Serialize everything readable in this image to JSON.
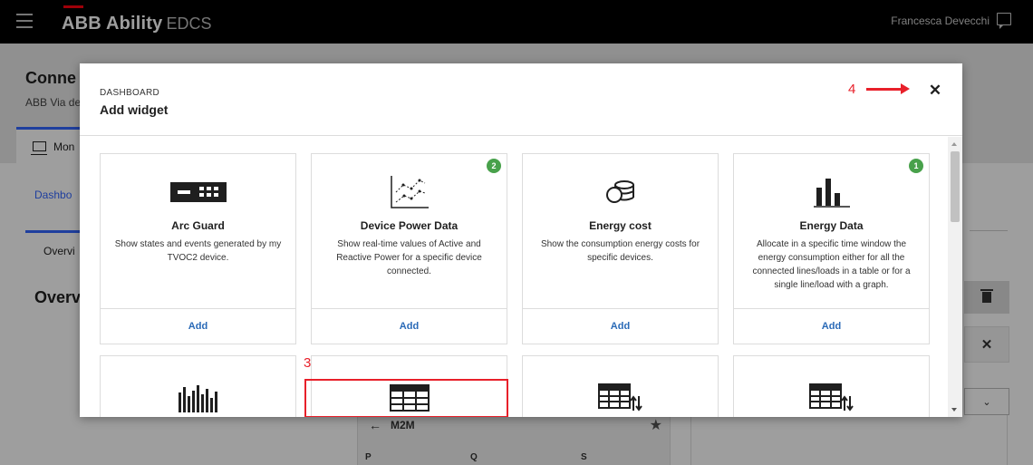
{
  "topbar": {
    "brand": "ABB Ability",
    "brand_suffix": "EDCS",
    "user_name": "Francesca Devecchi"
  },
  "background": {
    "title": "Conne",
    "subtitle": "ABB Via de",
    "tab_label": "Mon",
    "dashboard_link": "Dashbo",
    "overview_tab": "Overvi",
    "overview_title": "Overv",
    "table_title": "M2M",
    "columns": [
      "P",
      "Q",
      "S"
    ]
  },
  "modal": {
    "eyebrow": "DASHBOARD",
    "title": "Add widget",
    "annotations": {
      "step3": "3",
      "step4": "4"
    },
    "widgets": [
      {
        "icon": "arc-guard-icon",
        "title": "Arc Guard",
        "description": "Show states and events generated by my TVOC2 device.",
        "add_label": "Add",
        "badge": ""
      },
      {
        "icon": "line-chart-icon",
        "title": "Device Power Data",
        "description": "Show real-time values of Active and Reactive Power for a specific device connected.",
        "add_label": "Add",
        "badge": "2"
      },
      {
        "icon": "coins-icon",
        "title": "Energy cost",
        "description": "Show the consumption energy costs for specific devices.",
        "add_label": "Add",
        "badge": ""
      },
      {
        "icon": "bar-chart-icon",
        "title": "Energy Data",
        "description": "Allocate in a specific time window the energy consumption either for all the connected lines/loads in a table or for a single line/load with a graph.",
        "add_label": "Add",
        "badge": "1"
      }
    ],
    "widgets_row2_icons": [
      "histogram-icon",
      "table-icon",
      "table-sort-icon",
      "table-sort-icon"
    ]
  },
  "colors": {
    "accent_blue": "#2a6ab7",
    "annotation_red": "#e8202a",
    "badge_green": "#48a14b",
    "brand_red": "#ff000f"
  }
}
